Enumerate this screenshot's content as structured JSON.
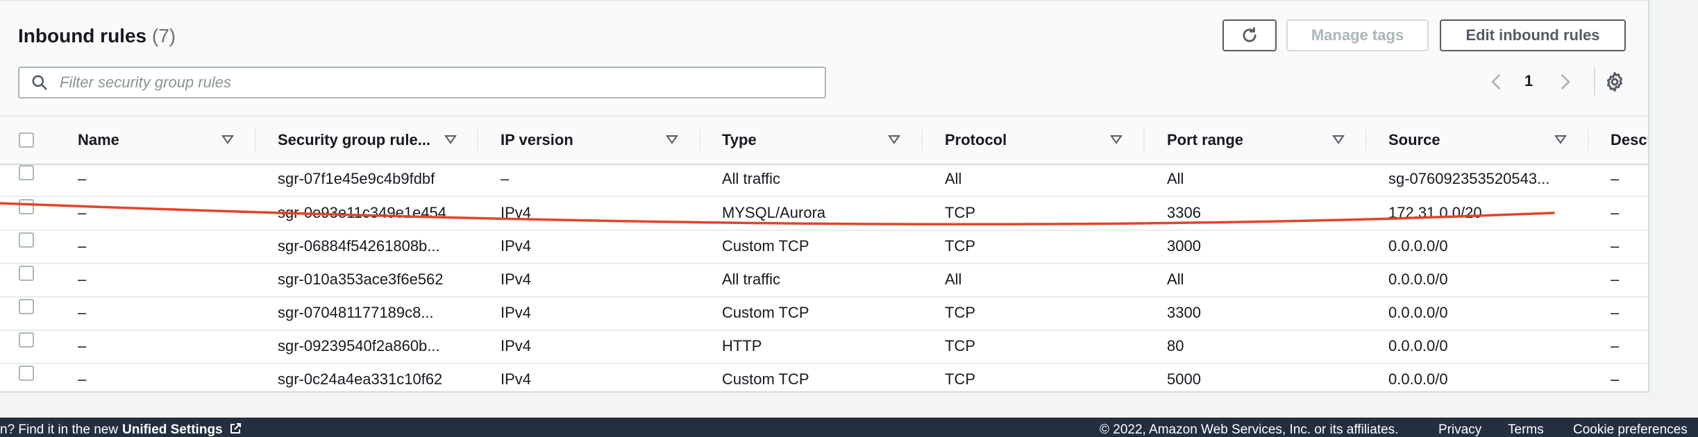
{
  "title": "Inbound rules",
  "count": "(7)",
  "buttons": {
    "manage_tags": "Manage tags",
    "edit_inbound": "Edit inbound rules"
  },
  "search": {
    "placeholder": "Filter security group rules"
  },
  "pagination": {
    "page": "1"
  },
  "columns": [
    "Name",
    "Security group rule...",
    "IP version",
    "Type",
    "Protocol",
    "Port range",
    "Source",
    "Descr"
  ],
  "rows": [
    {
      "name": "–",
      "rule_id": "sgr-07f1e45e9c4b9fdbf",
      "ip_version": "–",
      "type": "All traffic",
      "protocol": "All",
      "port_range": "All",
      "source": "sg-076092353520543...",
      "description": "–"
    },
    {
      "name": "–",
      "rule_id": "sgr-0e93e11c349e1e454",
      "ip_version": "IPv4",
      "type": "MYSQL/Aurora",
      "protocol": "TCP",
      "port_range": "3306",
      "source": "172.31.0.0/20",
      "description": "–"
    },
    {
      "name": "–",
      "rule_id": "sgr-06884f54261808b...",
      "ip_version": "IPv4",
      "type": "Custom TCP",
      "protocol": "TCP",
      "port_range": "3000",
      "source": "0.0.0.0/0",
      "description": "–"
    },
    {
      "name": "–",
      "rule_id": "sgr-010a353ace3f6e562",
      "ip_version": "IPv4",
      "type": "All traffic",
      "protocol": "All",
      "port_range": "All",
      "source": "0.0.0.0/0",
      "description": "–"
    },
    {
      "name": "–",
      "rule_id": "sgr-070481177189c8...",
      "ip_version": "IPv4",
      "type": "Custom TCP",
      "protocol": "TCP",
      "port_range": "3300",
      "source": "0.0.0.0/0",
      "description": "–"
    },
    {
      "name": "–",
      "rule_id": "sgr-09239540f2a860b...",
      "ip_version": "IPv4",
      "type": "HTTP",
      "protocol": "TCP",
      "port_range": "80",
      "source": "0.0.0.0/0",
      "description": "–"
    },
    {
      "name": "–",
      "rule_id": "sgr-0c24a4ea331c10f62",
      "ip_version": "IPv4",
      "type": "Custom TCP",
      "protocol": "TCP",
      "port_range": "5000",
      "source": "0.0.0.0/0",
      "description": "–"
    }
  ],
  "footer": {
    "left_text": "n? Find it in the new",
    "unified_settings": "Unified Settings",
    "copyright": "© 2022, Amazon Web Services, Inc. or its affiliates.",
    "privacy": "Privacy",
    "terms": "Terms",
    "cookie": "Cookie preferences"
  },
  "colors": {
    "annotation_line": "#e0452b",
    "footer_bg": "#232f3e"
  }
}
